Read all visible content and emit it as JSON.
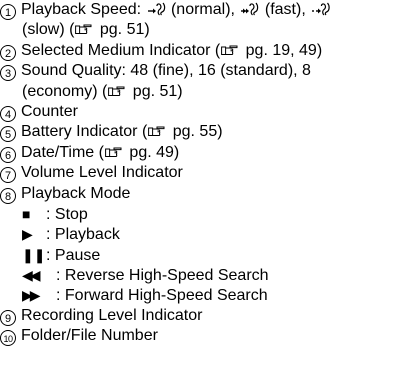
{
  "items": [
    {
      "num": "1",
      "parts": [
        "Playback Speed: ",
        " (normal), ",
        " (fast), ",
        "(slow) (",
        " pg. 51)"
      ]
    },
    {
      "num": "2",
      "parts": [
        "Selected Medium Indicator (",
        " pg. 19, 49)"
      ]
    },
    {
      "num": "3",
      "parts": [
        "Sound Quality: 48 (fine), 16 (standard), 8",
        "(economy) (",
        " pg. 51)"
      ]
    },
    {
      "num": "4",
      "parts": [
        "Counter"
      ]
    },
    {
      "num": "5",
      "parts": [
        "Battery Indicator (",
        " pg. 55)"
      ]
    },
    {
      "num": "6",
      "parts": [
        "Date/Time (",
        " pg. 49)"
      ]
    },
    {
      "num": "7",
      "parts": [
        "Volume Level Indicator"
      ]
    },
    {
      "num": "8",
      "parts": [
        "Playback Mode"
      ]
    },
    {
      "num": "9",
      "parts": [
        "Recording Level Indicator"
      ]
    },
    {
      "num": "10",
      "parts": [
        "Folder/File Number"
      ]
    }
  ],
  "playback_modes": [
    {
      "symbol": "■",
      "label": ": Stop"
    },
    {
      "symbol": "▶",
      "label": ": Playback"
    },
    {
      "symbol": "❚❚",
      "label": ": Pause"
    },
    {
      "symbol": "◀◀",
      "label": ": Reverse High-Speed Search"
    },
    {
      "symbol": "▶▶",
      "label": ": Forward High-Speed Search"
    }
  ],
  "icons": {
    "page_reference": "pointing-hand-icon",
    "speed_normal": "speed-normal-icon",
    "speed_fast": "speed-fast-icon",
    "speed_slow": "speed-slow-icon"
  }
}
